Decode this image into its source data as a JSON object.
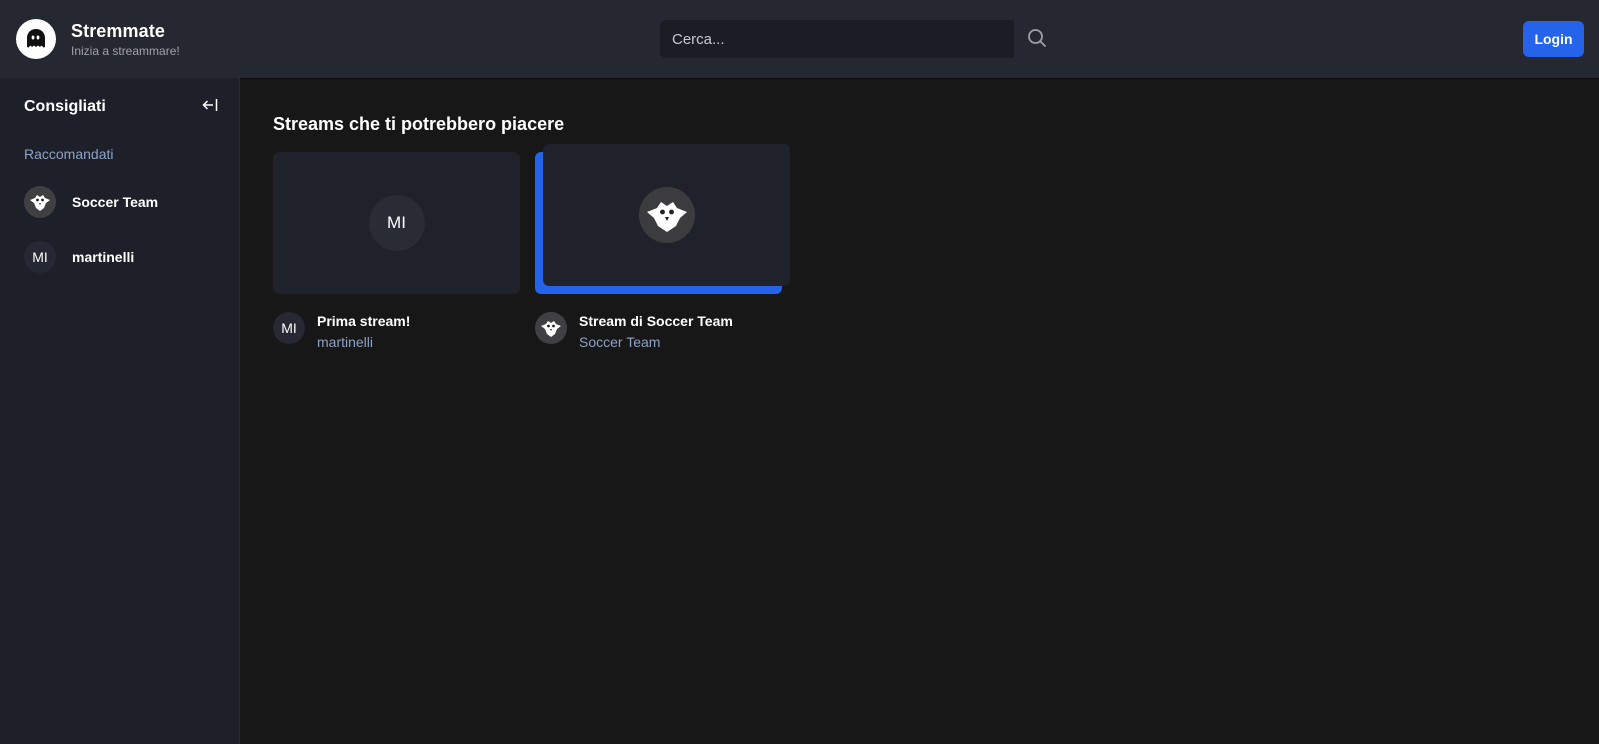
{
  "header": {
    "app_name": "Stremmate",
    "tagline": "Inizia a streammare!",
    "search_placeholder": "Cerca...",
    "login_label": "Login"
  },
  "sidebar": {
    "title": "Consigliati",
    "section_label": "Raccomandati",
    "items": [
      {
        "label": "Soccer Team",
        "avatar": "owl-logo"
      },
      {
        "label": "martinelli",
        "avatar_initials": "MI"
      }
    ]
  },
  "main": {
    "title": "Streams che ti potrebbero piacere",
    "streams": [
      {
        "title": "Prima stream!",
        "user": "martinelli",
        "initials": "MI",
        "thumbnail": "initials-avatar"
      },
      {
        "title": "Stream di Soccer Team",
        "user": "Soccer Team",
        "thumbnail": "owl-logo",
        "hovered": true
      }
    ]
  },
  "colors": {
    "topbar_bg": "#252731",
    "sidebar_bg": "#1e2029",
    "main_bg": "#171717",
    "accent": "#2563eb",
    "muted_link": "#8da2c4"
  }
}
